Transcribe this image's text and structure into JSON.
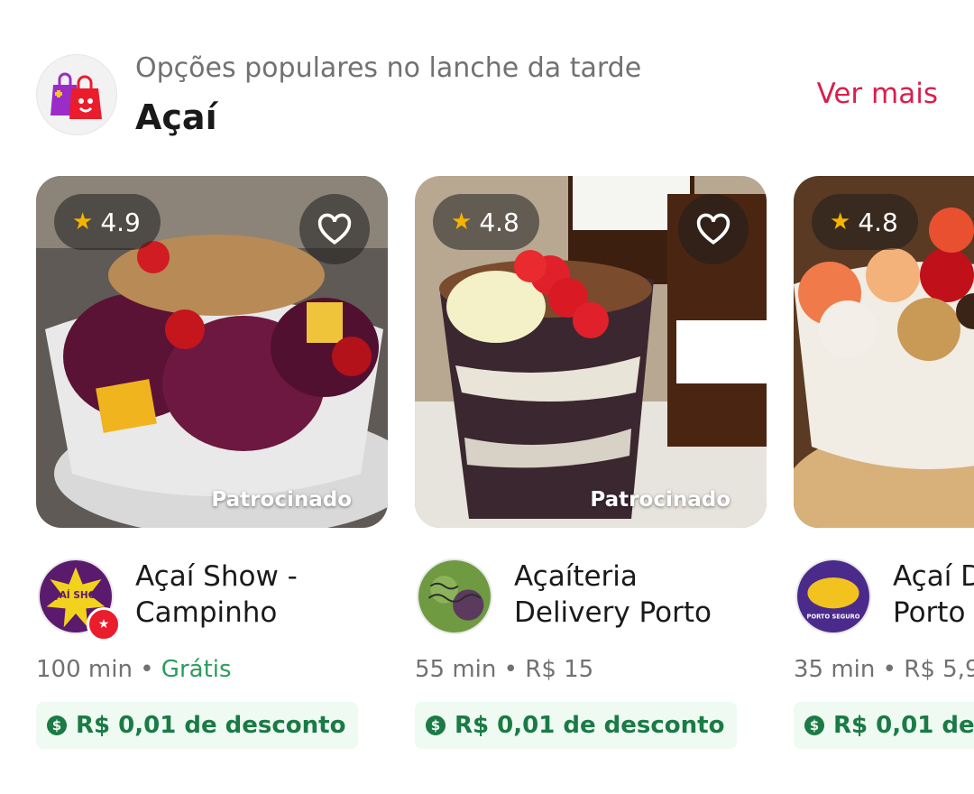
{
  "section": {
    "subtitle": "Opções populares no lanche da tarde",
    "title": "Açaí",
    "see_more": "Ver mais",
    "icon": "shopping-bags-icon"
  },
  "cards": [
    {
      "rating": "4.9",
      "sponsored": "Patrocinado",
      "store_name": "Açaí Show -\nCampinho",
      "logo_text": "AÇAÍ SHOW",
      "super_badge": true,
      "time": "100 min",
      "separator": "•",
      "fee": "Grátis",
      "discount": "R$ 0,01 de desconto"
    },
    {
      "rating": "4.8",
      "sponsored": "Patrocinado",
      "store_name": "Açaíteria\nDelivery  Porto",
      "logo_text": "",
      "super_badge": false,
      "time": "55 min",
      "separator": "•",
      "fee": "R$ 15",
      "discount": "R$ 0,01 de desconto"
    },
    {
      "rating": "4.8",
      "sponsored": "",
      "store_name": "Açaí D\nPorto",
      "logo_text": "PORTO SEGURO",
      "super_badge": false,
      "time": "35 min",
      "separator": "•",
      "fee": "R$ 5,9",
      "discount": "R$ 0,01 de"
    }
  ],
  "colors": {
    "accent": "#d81f4d",
    "free": "#2a9d5c",
    "discount_text": "#1b7a45",
    "discount_bg": "#eefaf2"
  }
}
